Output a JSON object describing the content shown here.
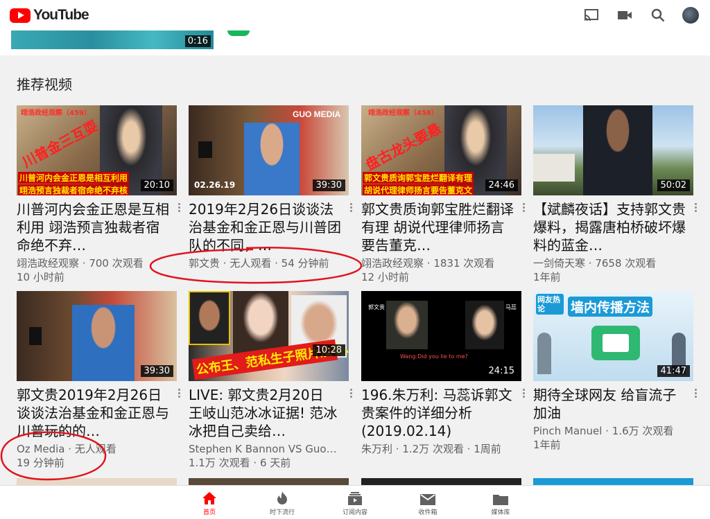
{
  "app": {
    "name": "YouTube"
  },
  "previous": {
    "duration": "0:16"
  },
  "section": {
    "title": "推荐视频"
  },
  "videos": [
    {
      "title": "川普河内会金正恩是互相利用 翊浩预言独裁者宿命绝不弃…",
      "channel": "翊浩政经观察",
      "views": "700 次观看",
      "age": "10 小时前",
      "duration": "20:10",
      "thumb_text": [
        "翊浩政经观察（459）",
        "川普金三互耍",
        "川普河内会金正恩是相互利用",
        "翊浩预言独裁者宿命绝不弃核"
      ]
    },
    {
      "title": "2019年2月26日谈谈法治基金和金正恩与川普团队的不同，…",
      "channel": "郭文贵",
      "views": "无人观看",
      "age": "54 分钟前",
      "duration": "39:30",
      "thumb_text": [
        "GUO MEDIA",
        "02.26.19"
      ]
    },
    {
      "title": "郭文贵质询郭宝胜烂翻译有理 胡说代理律师扬言要告董克…",
      "channel": "翊浩政经观察",
      "views": "1831 次观看",
      "age": "12 小时前",
      "duration": "24:46",
      "thumb_text": [
        "翊浩政经观察（458）",
        "盘古龙头要悬",
        "郭文贵质询郭宝胜烂翻译有理",
        "胡说代理律师扬言要告董克文"
      ]
    },
    {
      "title": "【斌麟夜话】支持郭文贵爆料，揭露唐柏桥破坏爆料的蓝金…",
      "channel": "一剑倚天寒",
      "views": "7658 次观看",
      "age": "1年前",
      "duration": "50:02",
      "thumb_text": []
    },
    {
      "title": "郭文贵2019年2月26日谈谈法治基金和金正恩与川普玩的的…",
      "channel": "Oz Media",
      "views": "无人观看",
      "age": "19 分钟前",
      "duration": "39:30",
      "thumb_text": []
    },
    {
      "title": "LIVE: 郭文贵2月20日 王岐山范冰冰证据! 范冰冰把自己卖给…",
      "channel": "Stephen K Bannon VS Guo…",
      "views": "1.1万 次观看",
      "age": "6 天前",
      "duration": "10:28",
      "thumb_text": [
        "公布王、范私生子照片及私…"
      ]
    },
    {
      "title": "196.朱万利: 马蕊诉郭文贵案件的详细分析(2019.02.14)",
      "channel": "朱万利",
      "views": "1.2万 次观看",
      "age": "1周前",
      "duration": "24:15",
      "thumb_text": [
        "郭文贵",
        "马蕊",
        "Wang:Did you lie to me?"
      ]
    },
    {
      "title": "期待全球网友 给盲流子加油",
      "channel": "Pinch Manuel",
      "views": "1.6万 次观看",
      "age": "1年前",
      "duration": "41:47",
      "thumb_text": [
        "网友热论",
        "墙内传播方法"
      ]
    }
  ],
  "nav": [
    {
      "label": "首页",
      "icon": "home-icon",
      "active": true
    },
    {
      "label": "时下流行",
      "icon": "trending-icon",
      "active": false
    },
    {
      "label": "订阅内容",
      "icon": "subscriptions-icon",
      "active": false
    },
    {
      "label": "收件箱",
      "icon": "inbox-icon",
      "active": false
    },
    {
      "label": "媒体库",
      "icon": "library-icon",
      "active": false
    }
  ],
  "colors": {
    "brand": "#ff0000",
    "annotation": "#e0141e",
    "background": "#f1f1f1"
  }
}
